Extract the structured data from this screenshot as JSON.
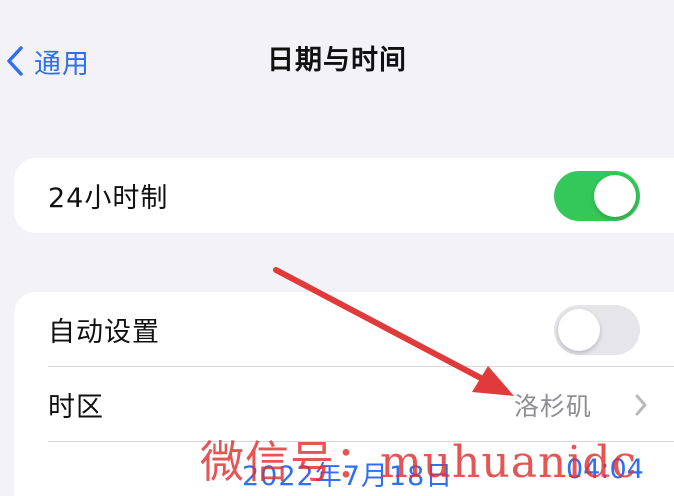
{
  "nav": {
    "back_label": "通用",
    "title": "日期与时间",
    "accent_color": "#2f6ff2"
  },
  "settings": {
    "hour24": {
      "label": "24小时制",
      "enabled": true
    },
    "auto_set": {
      "label": "自动设置",
      "enabled": false
    },
    "timezone": {
      "label": "时区",
      "value": "洛杉矶"
    },
    "datetime": {
      "date": "2022年7月18日",
      "time": "04:04"
    }
  },
  "colors": {
    "toggle_on": "#34c759",
    "toggle_off": "#e5e5ea",
    "background": "#f2f2f7",
    "annotation_arrow": "#e03a3a"
  },
  "icons": {
    "back": "chevron-left-icon",
    "disclosure": "chevron-right-icon",
    "annotation": "red-arrow"
  },
  "watermark": {
    "text": "微信号：muhuanidc"
  }
}
